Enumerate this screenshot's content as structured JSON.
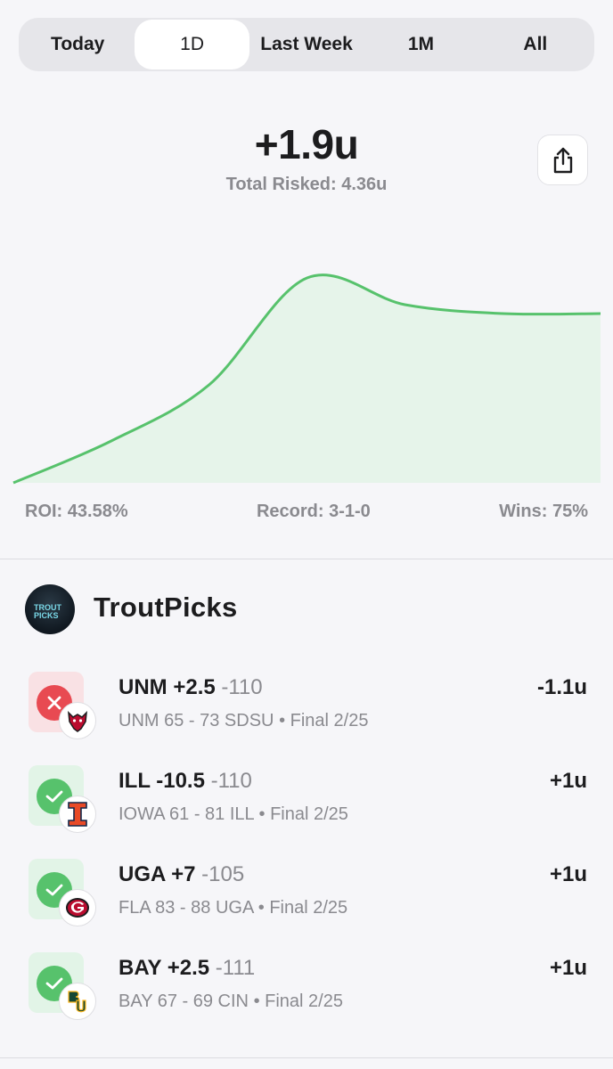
{
  "tabs": [
    {
      "label": "Today",
      "active": false
    },
    {
      "label": "1D",
      "active": true
    },
    {
      "label": "Last Week",
      "active": false
    },
    {
      "label": "1M",
      "active": false
    },
    {
      "label": "All",
      "active": false
    }
  ],
  "summary": {
    "profit": "+1.9u",
    "total_risked": "Total Risked: 4.36u"
  },
  "stats": {
    "roi": "ROI: 43.58%",
    "record": "Record: 3-1-0",
    "wins": "Wins: 75%"
  },
  "profile": {
    "name": "TroutPicks",
    "avatar_text": "TROUT PICKS"
  },
  "picks": [
    {
      "pick": "UNM +2.5",
      "odds": "-110",
      "result": "loss",
      "score": "UNM 65 - 73 SDSU",
      "status": "Final 2/25",
      "units": "-1.1u",
      "team_icon": "lobo-icon"
    },
    {
      "pick": "ILL -10.5",
      "odds": "-110",
      "result": "win",
      "score": "IOWA 61 - 81 ILL",
      "status": "Final 2/25",
      "units": "+1u",
      "team_icon": "illinois-i-icon"
    },
    {
      "pick": "UGA +7",
      "odds": "-105",
      "result": "win",
      "score": "FLA 83 - 88 UGA",
      "status": "Final 2/25",
      "units": "+1u",
      "team_icon": "georgia-g-icon"
    },
    {
      "pick": "BAY +2.5",
      "odds": "-111",
      "result": "win",
      "score": "BAY 67 - 69 CIN",
      "status": "Final 2/25",
      "units": "+1u",
      "team_icon": "baylor-bu-icon"
    }
  ],
  "chart_data": {
    "type": "area",
    "y": [
      0,
      0.47,
      1.1,
      2.3,
      2.0,
      1.9,
      1.9
    ],
    "color": "#57c26c",
    "fill": "#e6f4ea",
    "grid": false
  }
}
